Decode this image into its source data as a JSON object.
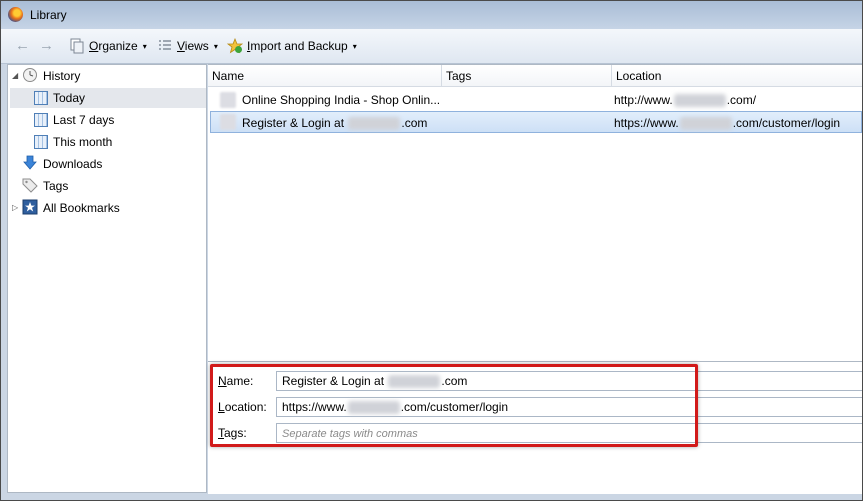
{
  "window": {
    "title": "Library"
  },
  "toolbar": {
    "back_label": "←",
    "forward_label": "→",
    "organize_accel": "O",
    "organize_rest": "rganize",
    "views_accel": "V",
    "views_rest": "iews",
    "import_accel": "I",
    "import_rest": "mport and Backup",
    "dropdown_glyph": "▾"
  },
  "sidebar": {
    "items": [
      {
        "label": "History",
        "icon": "clock-icon"
      },
      {
        "label": "Today",
        "icon": "calendar-icon"
      },
      {
        "label": "Last 7 days",
        "icon": "calendar-icon"
      },
      {
        "label": "This month",
        "icon": "calendar-icon"
      },
      {
        "label": "Downloads",
        "icon": "download-arrow-icon"
      },
      {
        "label": "Tags",
        "icon": "tag-icon"
      },
      {
        "label": "All Bookmarks",
        "icon": "bookmarks-star-icon"
      }
    ],
    "expanded_glyph": "◢",
    "collapsed_glyph": "▷",
    "selected_index": 1
  },
  "list": {
    "columns": [
      "Name",
      "Tags",
      "Location"
    ],
    "rows": [
      {
        "name": "Online Shopping India - Shop Onlin...",
        "tags": "",
        "location_prefix": "http://www.",
        "location_suffix": ".com/"
      },
      {
        "name_prefix": "Register & Login at ",
        "name_suffix": ".com",
        "tags": "",
        "location_prefix": "https://www.",
        "location_suffix": ".com/customer/login"
      }
    ],
    "selected_index": 1
  },
  "details": {
    "name_label_accel": "N",
    "name_label_rest": "ame:",
    "name_value_prefix": "Register & Login at ",
    "name_value_suffix": ".com",
    "location_label_accel": "L",
    "location_label_rest": "ocation:",
    "location_value_prefix": "https://www.",
    "location_value_suffix": ".com/customer/login",
    "tags_label_accel": "T",
    "tags_label_rest": "ags:",
    "tags_placeholder": "Separate tags with commas"
  },
  "colors": {
    "highlight": "#d11a1a",
    "selection": "#cde0f6"
  }
}
